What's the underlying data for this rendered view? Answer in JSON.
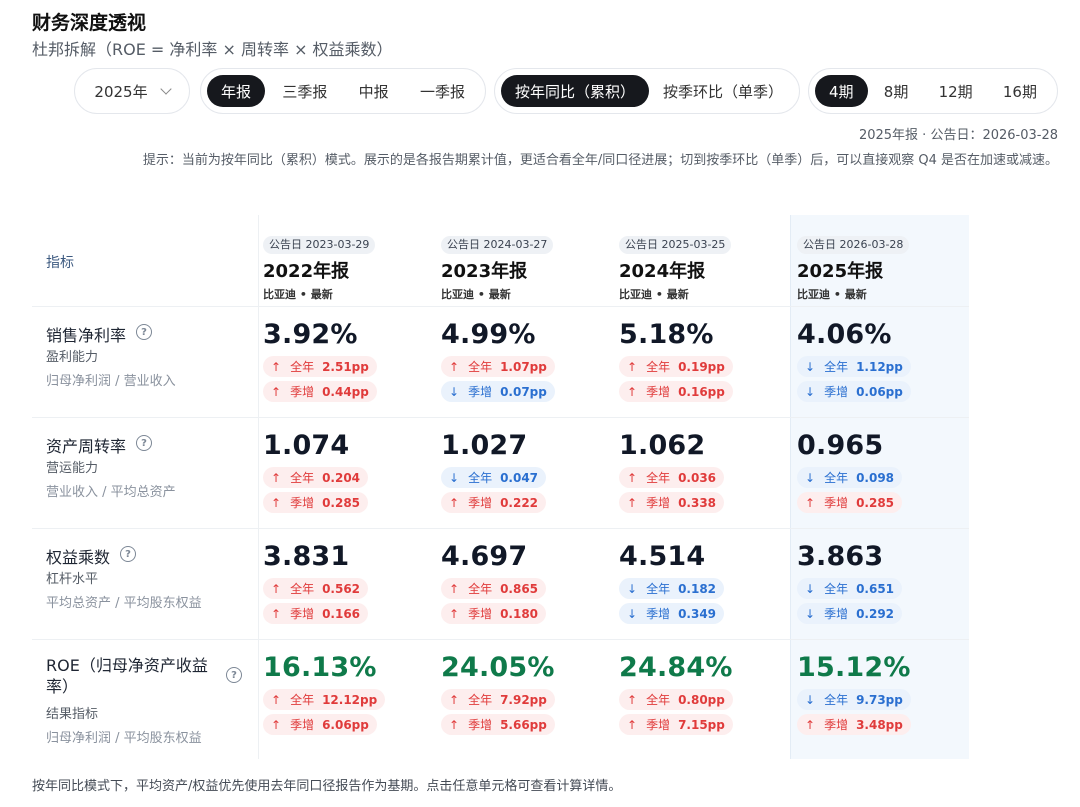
{
  "header": {
    "title": "财务深度透视",
    "subtitle": "杜邦拆解（ROE = 净利率 × 周转率 × 权益乘数）"
  },
  "controls": {
    "year": "2025年",
    "report_types": [
      {
        "label": "年报",
        "active": true
      },
      {
        "label": "三季报",
        "active": false
      },
      {
        "label": "中报",
        "active": false
      },
      {
        "label": "一季报",
        "active": false
      }
    ],
    "compare_modes": [
      {
        "label": "按年同比（累积）",
        "active": true
      },
      {
        "label": "按季环比（单季）",
        "active": false
      }
    ],
    "periods": [
      {
        "label": "4期",
        "active": true
      },
      {
        "label": "8期",
        "active": false
      },
      {
        "label": "12期",
        "active": false
      },
      {
        "label": "16期",
        "active": false
      }
    ]
  },
  "meta": "2025年报 · 公告日：2026-03-28",
  "hint": "提示：当前为按年同比（累积）模式。展示的是各报告期累计值，更适合看全年/同口径进展；切到按季环比（单季）后，可以直接观察 Q4 是否在加速或减速。",
  "table": {
    "header_label": "指标",
    "columns": [
      {
        "badge": "公告日 2023-03-29",
        "period": "2022年报",
        "company": "比亚迪 • 最新"
      },
      {
        "badge": "公告日 2024-03-27",
        "period": "2023年报",
        "company": "比亚迪 • 最新"
      },
      {
        "badge": "公告日 2025-03-25",
        "period": "2024年报",
        "company": "比亚迪 • 最新"
      },
      {
        "badge": "公告日 2026-03-28",
        "period": "2025年报",
        "company": "比亚迪 • 最新"
      }
    ],
    "rows": [
      {
        "name": "销售净利率",
        "category": "盈利能力",
        "formula": "归母净利润 / 营业收入",
        "green": false,
        "cells": [
          {
            "value": "3.92%",
            "yoy": {
              "label": "全年",
              "value": "2.51pp",
              "dir": "up"
            },
            "qoq": {
              "label": "季增",
              "value": "0.44pp",
              "dir": "up"
            }
          },
          {
            "value": "4.99%",
            "yoy": {
              "label": "全年",
              "value": "1.07pp",
              "dir": "up"
            },
            "qoq": {
              "label": "季增",
              "value": "0.07pp",
              "dir": "down"
            }
          },
          {
            "value": "5.18%",
            "yoy": {
              "label": "全年",
              "value": "0.19pp",
              "dir": "up"
            },
            "qoq": {
              "label": "季增",
              "value": "0.16pp",
              "dir": "up"
            }
          },
          {
            "value": "4.06%",
            "yoy": {
              "label": "全年",
              "value": "1.12pp",
              "dir": "down"
            },
            "qoq": {
              "label": "季增",
              "value": "0.06pp",
              "dir": "down"
            }
          }
        ]
      },
      {
        "name": "资产周转率",
        "category": "营运能力",
        "formula": "营业收入 / 平均总资产",
        "green": false,
        "cells": [
          {
            "value": "1.074",
            "yoy": {
              "label": "全年",
              "value": "0.204",
              "dir": "up"
            },
            "qoq": {
              "label": "季增",
              "value": "0.285",
              "dir": "up"
            }
          },
          {
            "value": "1.027",
            "yoy": {
              "label": "全年",
              "value": "0.047",
              "dir": "down"
            },
            "qoq": {
              "label": "季增",
              "value": "0.222",
              "dir": "up"
            }
          },
          {
            "value": "1.062",
            "yoy": {
              "label": "全年",
              "value": "0.036",
              "dir": "up"
            },
            "qoq": {
              "label": "季增",
              "value": "0.338",
              "dir": "up"
            }
          },
          {
            "value": "0.965",
            "yoy": {
              "label": "全年",
              "value": "0.098",
              "dir": "down"
            },
            "qoq": {
              "label": "季增",
              "value": "0.285",
              "dir": "up"
            }
          }
        ]
      },
      {
        "name": "权益乘数",
        "category": "杠杆水平",
        "formula": "平均总资产 / 平均股东权益",
        "green": false,
        "cells": [
          {
            "value": "3.831",
            "yoy": {
              "label": "全年",
              "value": "0.562",
              "dir": "up"
            },
            "qoq": {
              "label": "季增",
              "value": "0.166",
              "dir": "up"
            }
          },
          {
            "value": "4.697",
            "yoy": {
              "label": "全年",
              "value": "0.865",
              "dir": "up"
            },
            "qoq": {
              "label": "季增",
              "value": "0.180",
              "dir": "up"
            }
          },
          {
            "value": "4.514",
            "yoy": {
              "label": "全年",
              "value": "0.182",
              "dir": "down"
            },
            "qoq": {
              "label": "季增",
              "value": "0.349",
              "dir": "down"
            }
          },
          {
            "value": "3.863",
            "yoy": {
              "label": "全年",
              "value": "0.651",
              "dir": "down"
            },
            "qoq": {
              "label": "季增",
              "value": "0.292",
              "dir": "down"
            }
          }
        ]
      },
      {
        "name": "ROE（归母净资产收益率）",
        "category": "结果指标",
        "formula": "归母净利润 / 平均股东权益",
        "green": true,
        "cells": [
          {
            "value": "16.13%",
            "yoy": {
              "label": "全年",
              "value": "12.12pp",
              "dir": "up"
            },
            "qoq": {
              "label": "季增",
              "value": "6.06pp",
              "dir": "up"
            }
          },
          {
            "value": "24.05%",
            "yoy": {
              "label": "全年",
              "value": "7.92pp",
              "dir": "up"
            },
            "qoq": {
              "label": "季增",
              "value": "5.66pp",
              "dir": "up"
            }
          },
          {
            "value": "24.84%",
            "yoy": {
              "label": "全年",
              "value": "0.80pp",
              "dir": "up"
            },
            "qoq": {
              "label": "季增",
              "value": "7.15pp",
              "dir": "up"
            }
          },
          {
            "value": "15.12%",
            "yoy": {
              "label": "全年",
              "value": "9.73pp",
              "dir": "down"
            },
            "qoq": {
              "label": "季增",
              "value": "3.48pp",
              "dir": "up"
            }
          }
        ]
      }
    ]
  },
  "footer": "按年同比模式下，平均资产/权益优先使用去年同口径报告作为基期。点击任意单元格可查看计算详情。",
  "icons": {
    "help": "question-circle-icon",
    "up": "arrow-up-icon",
    "down": "arrow-down-icon",
    "select": "chevron-down-icon"
  },
  "colors": {
    "up": "#e03b3b",
    "down": "#2a6fd0",
    "roe": "#0f7a4a",
    "active": "#16181d"
  }
}
